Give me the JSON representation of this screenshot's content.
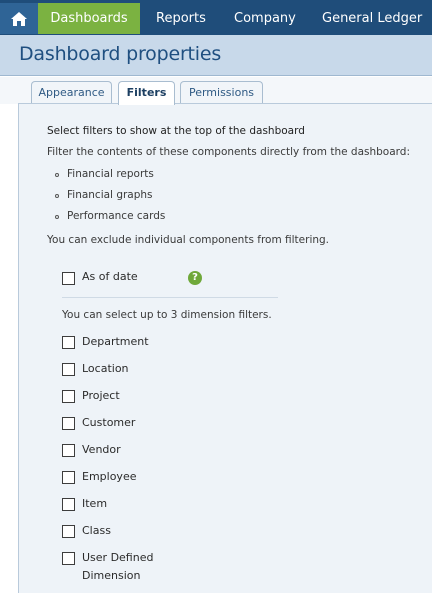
{
  "nav": {
    "items": [
      {
        "label": "Dashboards",
        "active": true
      },
      {
        "label": "Reports"
      },
      {
        "label": "Company"
      },
      {
        "label": "General Ledger"
      }
    ]
  },
  "page": {
    "title": "Dashboard properties"
  },
  "tabs": [
    {
      "label": "Appearance"
    },
    {
      "label": "Filters",
      "active": true
    },
    {
      "label": "Permissions"
    }
  ],
  "content": {
    "heading": "Select filters to show at the top of the dashboard",
    "description": "Filter the contents of these components directly from the dashboard:",
    "components": [
      "Financial reports",
      "Financial graphs",
      "Performance cards"
    ],
    "exclude_note": "You can exclude individual components from filtering.",
    "as_of_date": {
      "label": "As of date",
      "checked": false
    },
    "dimension_note": "You can select up to 3 dimension filters.",
    "dimensions": [
      {
        "label": "Department",
        "checked": false
      },
      {
        "label": "Location",
        "checked": false
      },
      {
        "label": "Project",
        "checked": false
      },
      {
        "label": "Customer",
        "checked": false
      },
      {
        "label": "Vendor",
        "checked": false
      },
      {
        "label": "Employee",
        "checked": false
      },
      {
        "label": "Item",
        "checked": false
      },
      {
        "label": "Class",
        "checked": false
      },
      {
        "label": "User Defined",
        "label_line2": "Dimension",
        "checked": false
      }
    ]
  },
  "colors": {
    "nav_bg": "#1f4d7a",
    "nav_active": "#7bb241",
    "title_bg": "#c8d9ea",
    "title_text": "#1f4f80",
    "help_icon": "#6fa83a"
  }
}
